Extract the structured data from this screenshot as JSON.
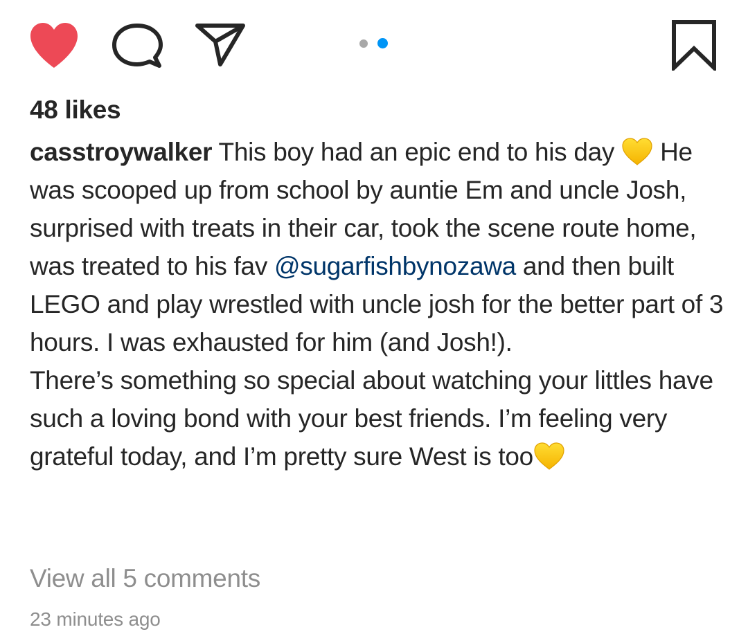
{
  "post": {
    "likes_text": "48 likes",
    "username": "casstroywalker",
    "caption": {
      "part1": " This boy had an epic end to his day ",
      "emoji1": "yellow-heart",
      "part2": " He was scooped up from school by auntie Em and uncle Josh, surprised with treats in their car, took the scene route home, was treated to his fav ",
      "mention": "@sugarfishbynozawa",
      "part3": " and then built LEGO and play wrestled with uncle josh for the better part of 3 hours. I was exhausted for him (and Josh!).",
      "para2_part1": "There’s something so special about watching your littles have such a loving bond with your best friends. I’m feeling very grateful today, and I’m pretty sure West is too",
      "emoji2": "yellow-heart"
    },
    "view_comments": "View all 5 comments",
    "timestamp": "23 minutes ago"
  },
  "actions": {
    "like_icon": "heart-filled-icon",
    "comment_icon": "comment-bubble-icon",
    "share_icon": "paper-plane-icon",
    "save_icon": "bookmark-icon"
  },
  "carousel": {
    "total": 2,
    "active_index": 1
  },
  "colors": {
    "like_red": "#ed4956",
    "text": "#262626",
    "muted": "#8e8e8e",
    "mention_blue": "#003569",
    "dot_active": "#0095f6",
    "dot_inactive": "#a8a8a8",
    "emoji_yellow": "#ffcc22"
  }
}
